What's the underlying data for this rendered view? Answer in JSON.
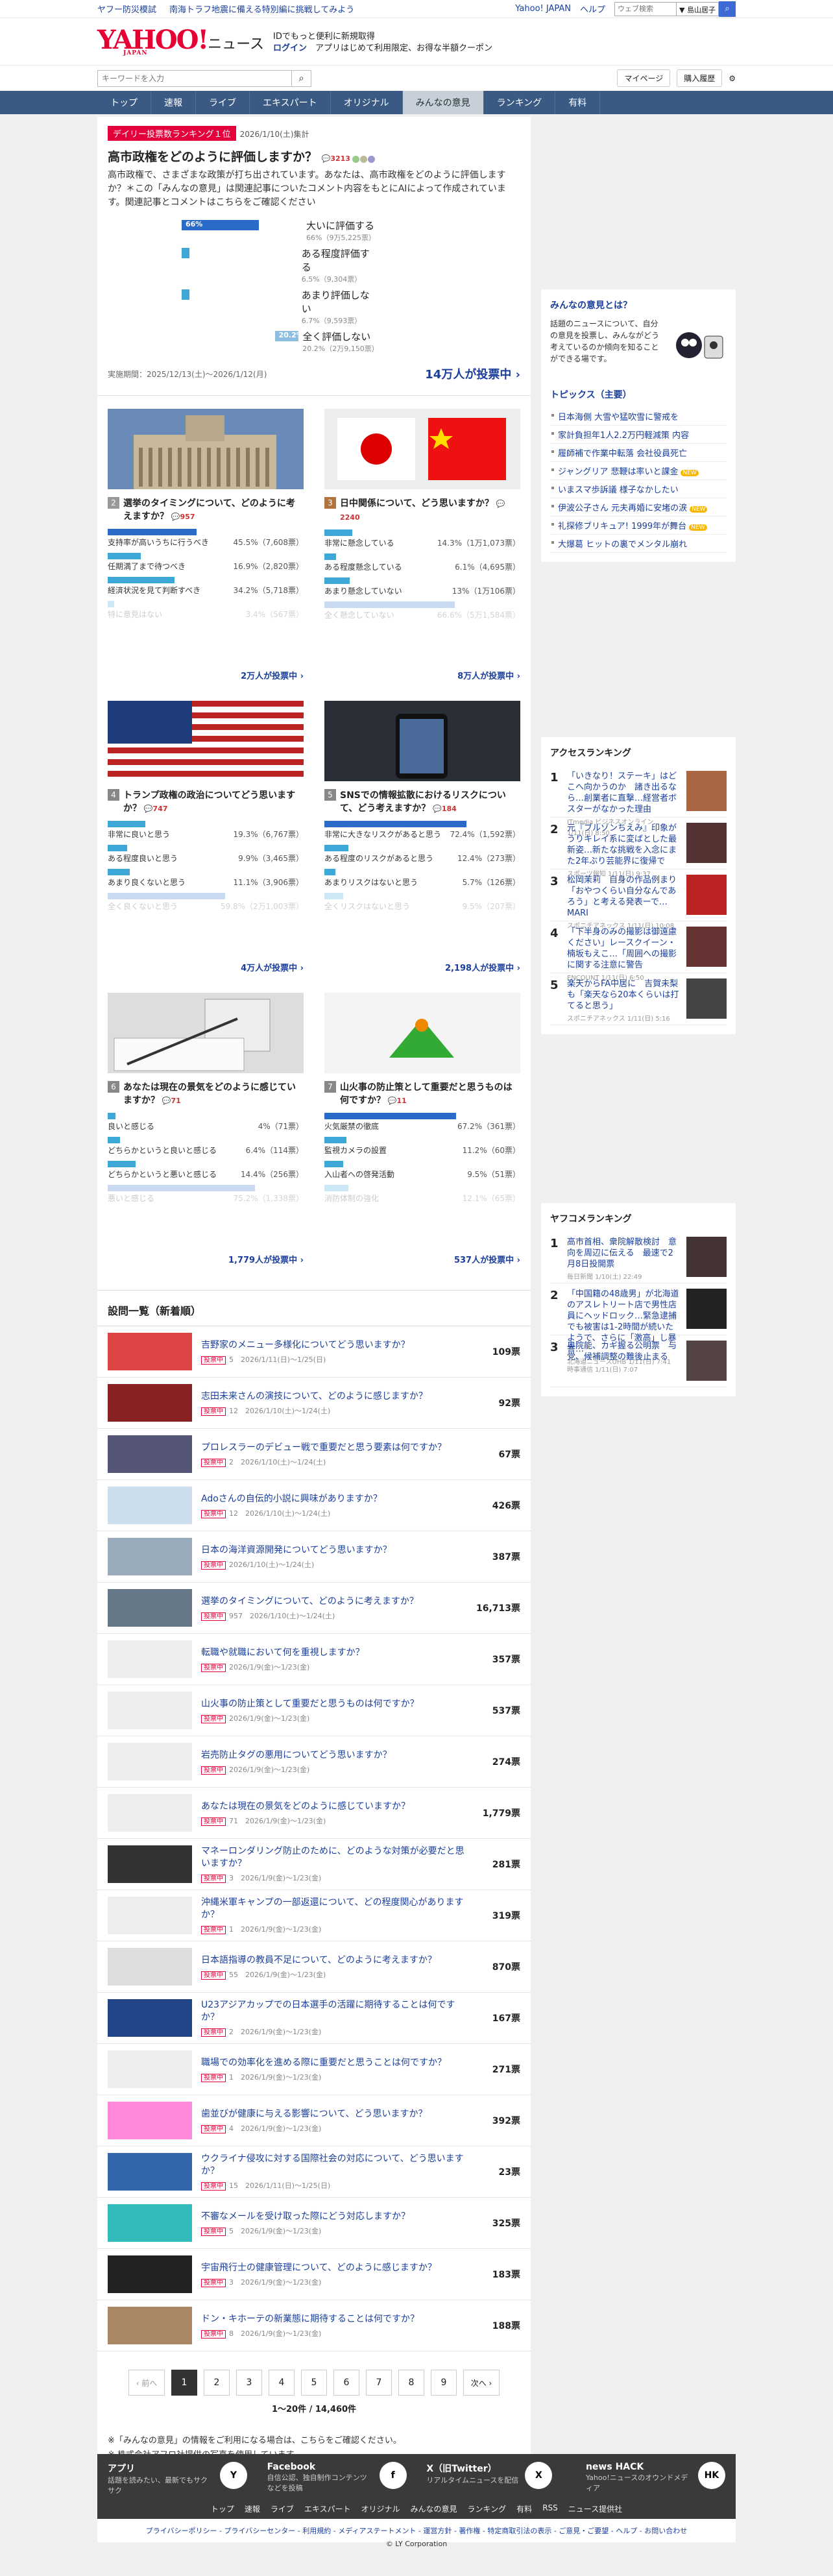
{
  "topstrip": {
    "links": [
      "ヤフー防災模試",
      "南海トラフ地震に備える特別編に挑戦してみよう"
    ],
    "yahoo": "Yahoo! JAPAN",
    "help": "ヘルプ",
    "search_placeholder": "ウェブ検索",
    "pref": "▼ 島山居子",
    "search_icon": "search-icon"
  },
  "header": {
    "brand": "YAHOO!",
    "brand_sub": "JAPAN",
    "news": "ニュース",
    "line1": "IDでもっと便利に新規取得",
    "line2": "ログイン",
    "line3": "アプリはじめて利用限定、お得な半額クーポン"
  },
  "search": {
    "placeholder": "キーワードを入力",
    "mypage": "マイページ",
    "history": "購入履歴"
  },
  "nav": [
    "トップ",
    "速報",
    "ライブ",
    "エキスパート",
    "オリジナル",
    "みんなの意見",
    "ランキング",
    "有料"
  ],
  "featured": {
    "badge": "デイリー投票数ランキング１位",
    "date": "2026/1/10(土)集計",
    "title": "高市政権をどのように評価しますか？",
    "comments": "3213",
    "desc": "高市政権で、さまざまな政策が打ち出されています。あなたは、高市政権をどのように評価しますか？＊この「みんなの意見」は関連記事についたコメント内容をもとにAIによって作成されています。関連記事とコメントはこちらをご確認ください",
    "options": [
      {
        "label": "大いに評価する",
        "pct": "66%",
        "detail": "66%（9万5,225票）",
        "value": 66
      },
      {
        "label": "ある程度評価する",
        "pct": "",
        "detail": "6.5%（9,304票）",
        "value": 6.5
      },
      {
        "label": "あまり評価しない",
        "pct": "",
        "detail": "6.7%（9,593票）",
        "value": 6.7
      },
      {
        "label": "全く評価しない",
        "pct": "20.2%",
        "detail": "20.2%（2万9,150票）",
        "value": 20.2
      }
    ],
    "period": "実施期間：2025/12/13(土)〜2026/1/12(月)",
    "votes": "14万人が投票中 ›"
  },
  "cards": [
    {
      "rank": "2",
      "title": "選挙のタイミングについて、どのように考えますか？",
      "cm": "957",
      "opts": [
        {
          "label": "支持率が高いうちに行うべき",
          "pct": "45.5%（7,608票）",
          "v": 45.5
        },
        {
          "label": "任期満了まで待つべき",
          "pct": "16.9%（2,820票）",
          "v": 16.9
        },
        {
          "label": "経済状況を見て判断すべき",
          "pct": "34.2%（5,718票）",
          "v": 34.2
        },
        {
          "label": "特に意見はない",
          "pct": "3.4%（567票）",
          "v": 3.4
        }
      ],
      "votes": "2万人が投票中 ›"
    },
    {
      "rank": "3",
      "title": "日中関係について、どう思いますか？",
      "cm": "2240",
      "opts": [
        {
          "label": "非常に懸念している",
          "pct": "14.3%（1万1,073票）",
          "v": 14.3
        },
        {
          "label": "ある程度懸念している",
          "pct": "6.1%（4,695票）",
          "v": 6.1
        },
        {
          "label": "あまり懸念していない",
          "pct": "13%（1万106票）",
          "v": 13
        },
        {
          "label": "全く懸念していない",
          "pct": "66.6%（5万1,584票）",
          "v": 66.6
        }
      ],
      "votes": "8万人が投票中 ›"
    },
    {
      "rank": "4",
      "title": "トランプ政権の政治についてどう思いますか？",
      "cm": "747",
      "opts": [
        {
          "label": "非常に良いと思う",
          "pct": "19.3%（6,767票）",
          "v": 19.3
        },
        {
          "label": "ある程度良いと思う",
          "pct": "9.9%（3,465票）",
          "v": 9.9
        },
        {
          "label": "あまり良くないと思う",
          "pct": "11.1%（3,906票）",
          "v": 11.1
        },
        {
          "label": "全く良くないと思う",
          "pct": "59.8%（2万1,003票）",
          "v": 59.8
        }
      ],
      "votes": "4万人が投票中 ›"
    },
    {
      "rank": "5",
      "title": "SNSでの情報拡散におけるリスクについて、どう考えますか？",
      "cm": "184",
      "opts": [
        {
          "label": "非常に大きなリスクがあると思う",
          "pct": "72.4%（1,592票）",
          "v": 72.4
        },
        {
          "label": "ある程度のリスクがあると思う",
          "pct": "12.4%（273票）",
          "v": 12.4
        },
        {
          "label": "あまりリスクはないと思う",
          "pct": "5.7%（126票）",
          "v": 5.7
        },
        {
          "label": "全くリスクはないと思う",
          "pct": "9.5%（207票）",
          "v": 9.5
        }
      ],
      "votes": "2,198人が投票中 ›"
    },
    {
      "rank": "6",
      "title": "あなたは現在の景気をどのように感じていますか？",
      "cm": "71",
      "opts": [
        {
          "label": "良いと感じる",
          "pct": "4%（71票）",
          "v": 4
        },
        {
          "label": "どちらかというと良いと感じる",
          "pct": "6.4%（114票）",
          "v": 6.4
        },
        {
          "label": "どちらかというと悪いと感じる",
          "pct": "14.4%（256票）",
          "v": 14.4
        },
        {
          "label": "悪いと感じる",
          "pct": "75.2%（1,338票）",
          "v": 75.2
        }
      ],
      "votes": "1,779人が投票中 ›"
    },
    {
      "rank": "7",
      "title": "山火事の防止策として重要だと思うものは何ですか？",
      "cm": "11",
      "opts": [
        {
          "label": "火気厳禁の徹底",
          "pct": "67.2%（361票）",
          "v": 67.2
        },
        {
          "label": "監視カメラの設置",
          "pct": "11.2%（60票）",
          "v": 11.2
        },
        {
          "label": "入山者への啓発活動",
          "pct": "9.5%（51票）",
          "v": 9.5
        },
        {
          "label": "消防体制の強化",
          "pct": "12.1%（65票）",
          "v": 12.1
        }
      ],
      "votes": "537人が投票中 ›"
    }
  ],
  "list_heading": "設問一覧（新着順）",
  "list": [
    {
      "t": "吉野家のメニュー多様化についてどう思いますか？",
      "m": "5　2026/1/11(日)〜1/25(日)",
      "v": "109票",
      "c": "#d44"
    },
    {
      "t": "志田未来さんの演技について、どのように感じますか？",
      "m": "12　2026/1/10(土)〜1/24(土)",
      "v": "92票",
      "c": "#822"
    },
    {
      "t": "プロレスラーのデビュー戦で重要だと思う要素は何ですか？",
      "m": "2　2026/1/10(土)〜1/24(土)",
      "v": "67票",
      "c": "#557"
    },
    {
      "t": "Adoさんの自伝的小説に興味がありますか？",
      "m": "12　2026/1/10(土)〜1/24(土)",
      "v": "426票",
      "c": "#cde"
    },
    {
      "t": "日本の海洋資源開発についてどう思いますか？",
      "m": "2026/1/10(土)〜1/24(土)",
      "v": "387票",
      "c": "#9ab"
    },
    {
      "t": "選挙のタイミングについて、どのように考えますか？",
      "m": "957　2026/1/10(土)〜1/24(土)",
      "v": "16,713票",
      "c": "#678"
    },
    {
      "t": "転職や就職において何を重視しますか？",
      "m": "2026/1/9(金)〜1/23(金)",
      "v": "357票",
      "c": "#eee"
    },
    {
      "t": "山火事の防止策として重要だと思うものは何ですか？",
      "m": "2026/1/9(金)〜1/23(金)",
      "v": "537票",
      "c": "#eee"
    },
    {
      "t": "岩売防止タグの悪用についてどう思いますか？",
      "m": "2026/1/9(金)〜1/23(金)",
      "v": "274票",
      "c": "#eee"
    },
    {
      "t": "あなたは現在の景気をどのように感じていますか？",
      "m": "71　2026/1/9(金)〜1/23(金)",
      "v": "1,779票",
      "c": "#eee"
    },
    {
      "t": "マネーロンダリング防止のために、どのような対策が必要だと思いますか？",
      "m": "3　2026/1/9(金)〜1/23(金)",
      "v": "281票",
      "c": "#333"
    },
    {
      "t": "沖縄米軍キャンプの一部返還について、どの程度関心がありますか？",
      "m": "1　2026/1/9(金)〜1/23(金)",
      "v": "319票",
      "c": "#eee"
    },
    {
      "t": "日本語指導の教員不足について、どのように考えますか？",
      "m": "55　2026/1/9(金)〜1/23(金)",
      "v": "870票",
      "c": "#ddd"
    },
    {
      "t": "U23アジアカップでの日本選手の活躍に期待することは何ですか？",
      "m": "2　2026/1/9(金)〜1/23(金)",
      "v": "167票",
      "c": "#248"
    },
    {
      "t": "職場での効率化を進める際に重要だと思うことは何ですか？",
      "m": "1　2026/1/9(金)〜1/23(金)",
      "v": "271票",
      "c": "#eee"
    },
    {
      "t": "歯並びが健康に与える影響について、どう思いますか？",
      "m": "4　2026/1/9(金)〜1/23(金)",
      "v": "392票",
      "c": "#f8d"
    },
    {
      "t": "ウクライナ侵攻に対する国際社会の対応について、どう思いますか？",
      "m": "15　2026/1/11(日)〜1/25(日)",
      "v": "23票",
      "c": "#36a"
    },
    {
      "t": "不審なメールを受け取った際にどう対応しますか？",
      "m": "5　2026/1/9(金)〜1/23(金)",
      "v": "325票",
      "c": "#3bb"
    },
    {
      "t": "宇宙飛行士の健康管理について、どのように感じますか？",
      "m": "3　2026/1/9(金)〜1/23(金)",
      "v": "183票",
      "c": "#222"
    },
    {
      "t": "ドン・キホーテの新業態に期待することは何ですか？",
      "m": "8　2026/1/9(金)〜1/23(金)",
      "v": "188票",
      "c": "#a86"
    }
  ],
  "list_tag": "投票中",
  "pager": {
    "prev": "‹ 前へ",
    "pages": [
      "1",
      "2",
      "3",
      "4",
      "5",
      "6",
      "7",
      "8",
      "9"
    ],
    "next": "次へ ›",
    "info": "1〜20件 / 14,460件"
  },
  "notes": [
    "※「みんなの意見」の情報をご利用になる場合は、こちらをご確認ください。",
    "※ 株式会社アフロ社提供の写真を使用しています。"
  ],
  "side": {
    "about_title": "みんなの意見とは？",
    "about_text": "話題のニュースについて、自分の意見を投票し、みんながどう考えているのか傾向を知ることができる場です。",
    "topics_title": "トピックス（主要）",
    "topics": [
      "日本海側 大雪や猛吹雪に警戒を",
      "家計負担年1人2.2万円軽減策 内容",
      "履師補で作業中転落 会社役員死亡",
      "ジャングリア 悲鞭は率いと課金",
      "いまスマ歩訴議 様子なかしたい",
      "伊波公子さん 元夫再婚に安堵の涙",
      "礼探修ブリキュア! 1999年が舞台",
      "大爆葛 ヒットの裏でメンタル崩れ"
    ],
    "topics_new": [
      false,
      false,
      false,
      true,
      false,
      true,
      true,
      false
    ],
    "access_title": "アクセスランキング",
    "access": [
      {
        "t": "「いきなり！ステーキ」はどこへ向かうのか　諸き出るなら…創業者に直撃…経営者ボスターがなかった理由",
        "s": "ITmedia ビジネスオンライン 1/11(日) 8:50",
        "c": "#a64"
      },
      {
        "t": "元『ブルゾンちえみ』印象がうりキレイ系に変ばとした最新姿…新たな挑戦を入念にまた2年ぶり芸能界に復帰で",
        "s": "スポーツ報知 1/11(日) 9:37",
        "c": "#533"
      },
      {
        "t": "松岡茉莉　自身の作品例まり　「おやつくらい自分なんであろう」と考える発表ーで…MARI",
        "s": "スポニチアネックス 1/11(日) 10:08",
        "c": "#b22"
      },
      {
        "t": "「下半身のみの撮影は御遠慮ください」レースクイーン・楠坂もえこ…「周囲への撮影に関する注意に警告",
        "s": "ENCOUNT 1/11(日) 6:50",
        "c": "#633"
      },
      {
        "t": "楽天からFA中居に　吉賀未梨も「楽天なら20本くらいは打てると思う」",
        "s": "スポニチアネックス 1/11(日) 5:16",
        "c": "#444"
      }
    ],
    "yahoo_title": "ヤフコメランキング",
    "yahoo": [
      {
        "t": "高市首相、衆院解散検討　意向を周辺に伝える　最速で2月8日投開票",
        "s": "毎日新聞 1/10(土) 22:49",
        "c": "#433"
      },
      {
        "t": "「中国籍の48歳男」が北海道のアスレトリート店で男性店員にヘッドロック…緊急逮捕でも被害は1-2時間が続いたようで、さらに「激高」し暴言…",
        "s": "北海道ニュースUHB 1/11(日) 7:41",
        "c": "#222"
      },
      {
        "t": "奥院能、カギ握る公明票　与党、候補調整の難後止まる",
        "s": "時事通信 1/11(日) 7:07",
        "c": "#544"
      }
    ]
  },
  "footer": {
    "apps": [
      {
        "t": "アプリ",
        "s": "話題を読みたい、最新でもサクサク",
        "ic": "Y"
      },
      {
        "t": "Facebook",
        "s": "自信公認、独自制作コンテンツなどを投稿",
        "ic": "f"
      },
      {
        "t": "X（旧Twitter）",
        "s": "リアルタイムニュースを配信",
        "ic": "X"
      },
      {
        "t": "news HACK",
        "s": "Yahoo!ニュースのオウンドメディア",
        "ic": "HK"
      }
    ],
    "links": [
      "トップ",
      "速報",
      "ライブ",
      "エキスパート",
      "オリジナル",
      "みんなの意見",
      "ランキング",
      "有料",
      "RSS",
      "ニュース提供社"
    ],
    "legal": "プライバシーポリシー - プライバシーセンター - 利用規約 - メディアステートメント - 運営方針 - 著作権 - 特定商取引法の表示 - ご意見・ご要望 - ヘルプ - お問い合わせ",
    "copy": "© LY Corporation"
  }
}
